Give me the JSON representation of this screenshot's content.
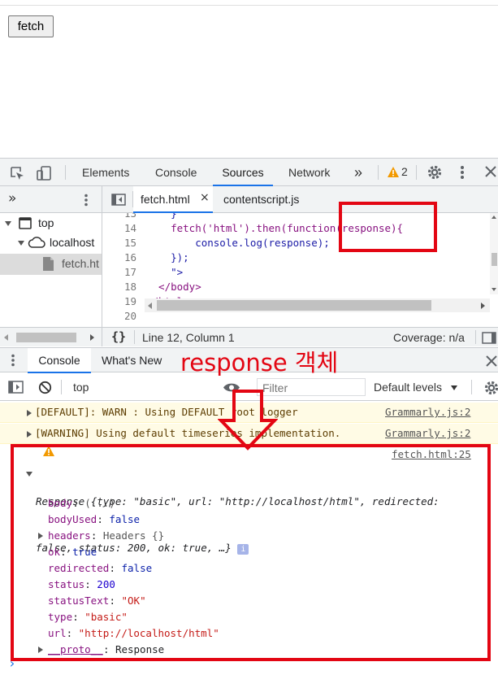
{
  "page": {
    "button_label": "fetch"
  },
  "devtools": {
    "tabs": [
      "Elements",
      "Console",
      "Sources",
      "Network"
    ],
    "more_tabs": "»",
    "warning_count": "2",
    "navigator": {
      "more": "»",
      "tree": [
        {
          "label": "top"
        },
        {
          "label": "localhost"
        },
        {
          "label": "fetch.ht"
        }
      ]
    },
    "editor": {
      "file_tabs": [
        "fetch.html",
        "contentscript.js"
      ],
      "close_glyph": "×",
      "lines": [
        {
          "num": "13",
          "text": "    }"
        },
        {
          "num": "14",
          "text": "    fetch('html').then(function(response){"
        },
        {
          "num": "15",
          "text": "        console.log(response);"
        },
        {
          "num": "16",
          "text": "    });"
        },
        {
          "num": "17",
          "text": "    \">"
        },
        {
          "num": "18",
          "text": "  </body>"
        },
        {
          "num": "19",
          "text": "</html>"
        },
        {
          "num": "20",
          "text": ""
        }
      ]
    },
    "status": {
      "braces": "{}",
      "position": "Line 12, Column 1",
      "coverage": "Coverage: n/a"
    },
    "drawer": {
      "tabs": [
        "Console",
        "What's New"
      ]
    },
    "console_toolbar": {
      "context": "top",
      "filter_placeholder": "Filter",
      "levels": "Default levels"
    },
    "messages": [
      {
        "text": "[DEFAULT]: WARN : Using DEFAULT root logger",
        "source": "Grammarly.js:2"
      },
      {
        "text": "[WARNING] Using default timeseries implementation.",
        "source": "Grammarly.js:2"
      }
    ],
    "log": {
      "source": "fetch.html:25",
      "summary_line1": "Response {type: \"basic\", url: \"http://localhost/html\", redirected:",
      "summary_line2": "false, status: 200, ok: true, …}",
      "info_badge": "i",
      "props": [
        {
          "key": "body",
          "value": "(...)",
          "kind": "gray",
          "expandable": false
        },
        {
          "key": "bodyUsed",
          "value": "false",
          "kind": "kw",
          "expandable": false
        },
        {
          "key": "headers",
          "value": "Headers {}",
          "kind": "gray",
          "expandable": true
        },
        {
          "key": "ok",
          "value": "true",
          "kind": "kw",
          "expandable": false
        },
        {
          "key": "redirected",
          "value": "false",
          "kind": "kw",
          "expandable": false
        },
        {
          "key": "status",
          "value": "200",
          "kind": "num",
          "expandable": false
        },
        {
          "key": "statusText",
          "value": "\"OK\"",
          "kind": "str",
          "expandable": false
        },
        {
          "key": "type",
          "value": "\"basic\"",
          "kind": "str",
          "expandable": false
        },
        {
          "key": "url",
          "value": "\"http://localhost/html\"",
          "kind": "str",
          "expandable": false
        },
        {
          "key": "__proto__",
          "value": "Response",
          "kind": "plain",
          "expandable": true
        }
      ],
      "prompt": "›"
    }
  },
  "annotation": {
    "label": "response 객체",
    "color": "#e30613"
  }
}
